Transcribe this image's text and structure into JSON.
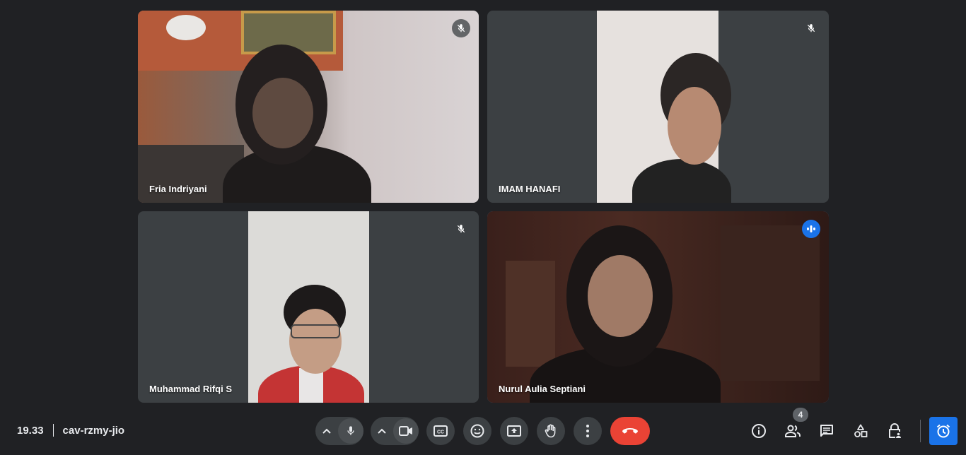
{
  "participants": [
    {
      "name": "Fria Indriyani",
      "mic": "muted"
    },
    {
      "name": "IMAM HANAFI",
      "mic": "muted"
    },
    {
      "name": "Muhammad Rifqi S",
      "mic": "muted"
    },
    {
      "name": "Nurul Aulia Septiani",
      "mic": "speaking"
    }
  ],
  "meeting": {
    "time": "19.33",
    "code": "cav-rzmy-jio"
  },
  "people_count": "4",
  "icons": {
    "mic": "mic-icon",
    "camera": "videocam-icon",
    "captions": "closed-caption-icon",
    "emoji": "emoji-icon",
    "present": "present-screen-icon",
    "raise_hand": "hand-icon",
    "more": "more-vert-icon",
    "end": "call-end-icon",
    "info": "info-icon",
    "people": "people-icon",
    "chat": "chat-icon",
    "activities": "shapes-icon",
    "host": "lock-person-icon",
    "timer": "alarm-icon"
  },
  "colors": {
    "background": "#202124",
    "tile": "#3c4043",
    "end_call": "#ea4335",
    "accent": "#1a73e8",
    "speaking_border": "#4a9cf1"
  }
}
